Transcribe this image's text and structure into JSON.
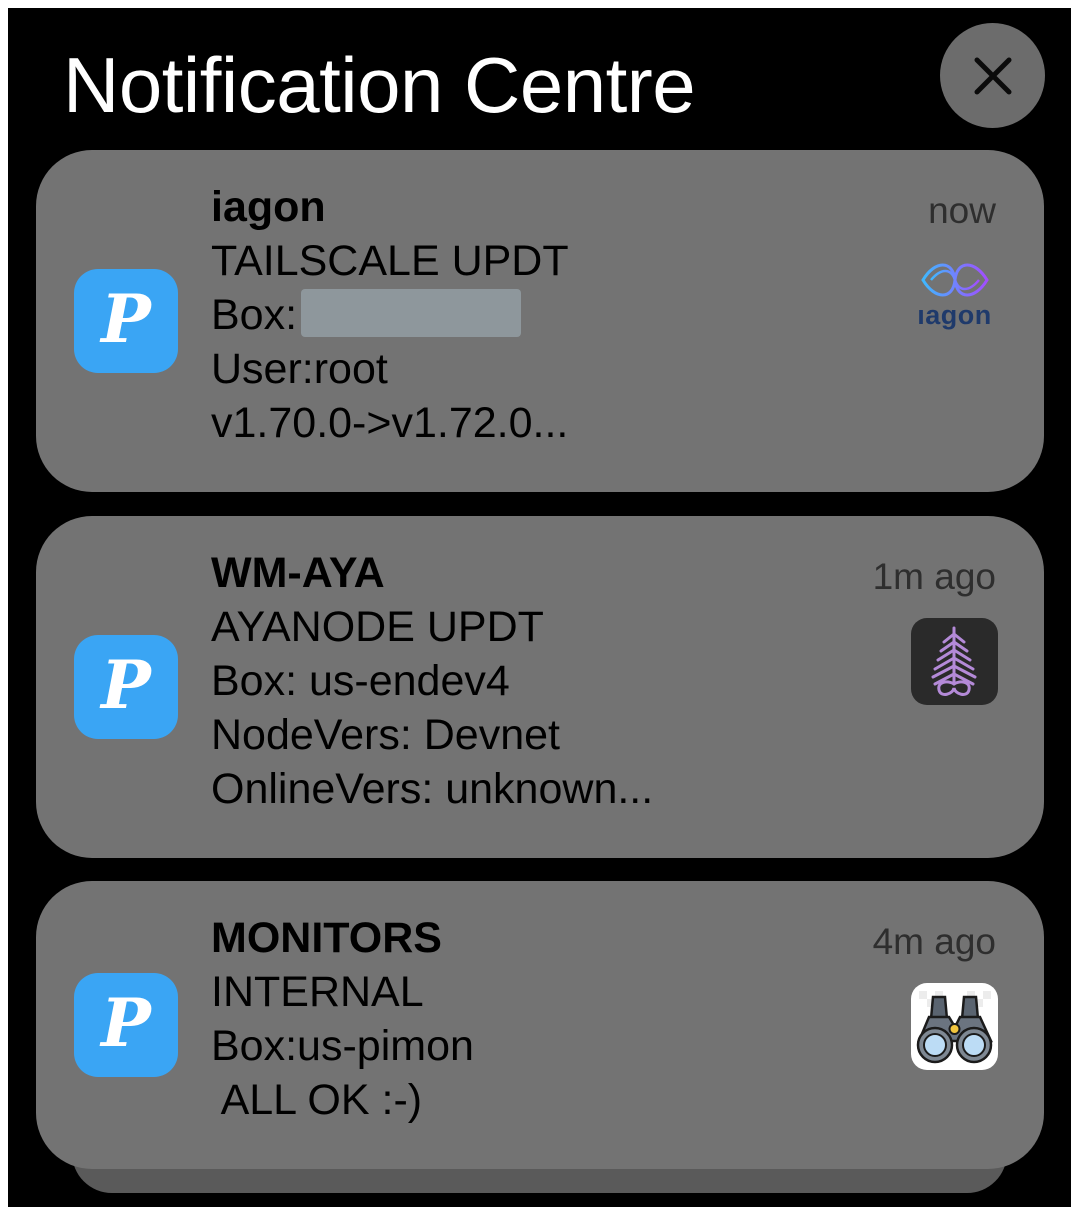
{
  "header": {
    "title": "Notification Centre"
  },
  "close_icon": "close-icon",
  "app_icon": {
    "glyph": "P",
    "color": "#3aa5f4"
  },
  "notifications": [
    {
      "app": "iagon",
      "time": "now",
      "lines": [
        "TAILSCALE UPDT",
        "Box:",
        "User:root",
        "v1.70.0->v1.72.0..."
      ],
      "thumbnail": {
        "name": "iagon-logo",
        "text": "ıagon"
      }
    },
    {
      "app": "WM-AYA",
      "time": "1m ago",
      "lines": [
        "AYANODE UPDT",
        "Box: us-endev4",
        "NodeVers: Devnet",
        "OnlineVers: unknown..."
      ],
      "thumbnail": {
        "name": "aya-logo"
      }
    },
    {
      "app": "MONITORS",
      "time": "4m ago",
      "lines": [
        "INTERNAL",
        "Box:us-pimon",
        " ALL OK :-)"
      ],
      "thumbnail": {
        "name": "binoculars-icon"
      }
    }
  ]
}
